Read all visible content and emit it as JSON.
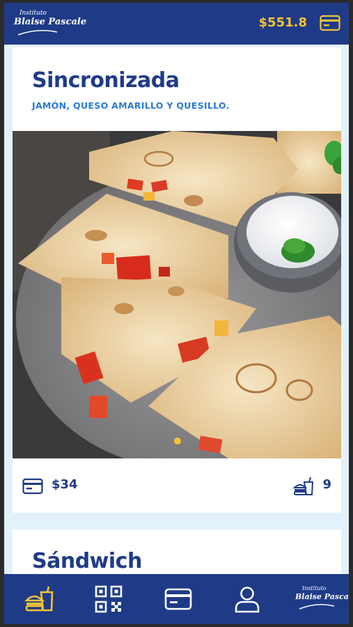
{
  "header": {
    "logo_line1": "Instituto",
    "logo_line2": "Blaise Pascale",
    "balance": "$551.8",
    "wallet_icon": "card-icon"
  },
  "products": [
    {
      "name": "Sincronizada",
      "description": "JAMÓN, QUESO AMARILLO Y QUESILLO.",
      "image": "quesadilla-photo",
      "price": "$34",
      "available": "9",
      "carousel_dots": 1
    },
    {
      "name": "Sándwich"
    }
  ],
  "nav": {
    "items": [
      {
        "name": "menu",
        "icon": "burger-combo-icon",
        "active": true
      },
      {
        "name": "qr",
        "icon": "qr-code-icon",
        "active": false
      },
      {
        "name": "card",
        "icon": "card-icon",
        "active": false
      },
      {
        "name": "profile",
        "icon": "user-icon",
        "active": false
      },
      {
        "name": "school",
        "icon": "school-logo",
        "active": false
      }
    ],
    "logo_line1": "Instituto",
    "logo_line2": "Blaise Pascale"
  },
  "colors": {
    "primary": "#1f3b87",
    "accent": "#f4c430",
    "link": "#2a7ad0",
    "background": "#e3f2fa"
  }
}
